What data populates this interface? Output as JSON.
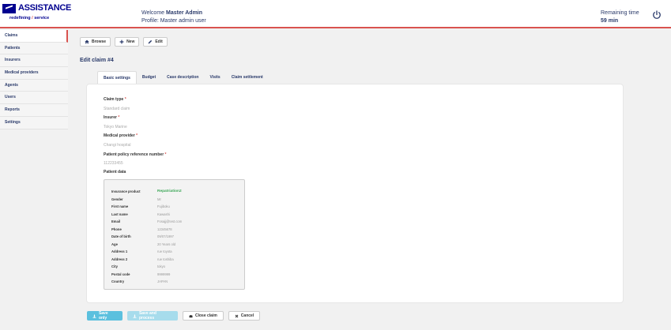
{
  "header": {
    "brand": "ASSISTANCE",
    "tagline_a": "redefining",
    "tagline_slash": "/",
    "tagline_b": "service",
    "welcome_prefix": "Welcome",
    "welcome_name": "Master Admin",
    "profile": "Profile: Master admin user",
    "remaining_label": "Remaining time",
    "remaining_value": "59 min"
  },
  "sidebar": {
    "items": [
      {
        "label": "Claims"
      },
      {
        "label": "Patients"
      },
      {
        "label": "Insurers"
      },
      {
        "label": "Medical providers"
      },
      {
        "label": "Agents"
      },
      {
        "label": "Users"
      },
      {
        "label": "Reports"
      },
      {
        "label": "Settings"
      }
    ]
  },
  "toolbar": {
    "browse": "Browse",
    "new": "New",
    "edit": "Edit"
  },
  "page": {
    "title": "Edit claim #4"
  },
  "tabs": [
    {
      "label": "Basic settings"
    },
    {
      "label": "Budget"
    },
    {
      "label": "Case description"
    },
    {
      "label": "Visits"
    },
    {
      "label": "Claim settlement"
    }
  ],
  "form": {
    "claim_type_label": "Claim type",
    "claim_type_value": "Standard claim",
    "insurer_label": "Insurer",
    "insurer_value": "Tokyo Marine",
    "provider_label": "Medical provider",
    "provider_value": "Changi hospital",
    "policy_label": "Patient policy reference number",
    "policy_value": "112233455",
    "patient_data_label": "Patient data",
    "required_mark": "*"
  },
  "patient": {
    "rows": [
      {
        "key": "Insurance product",
        "value": "Repatriation2"
      },
      {
        "key": "Gender",
        "value": "Mr"
      },
      {
        "key": "First name",
        "value": "Fujiboku"
      },
      {
        "key": "Last name",
        "value": "Kawashi"
      },
      {
        "key": "Email",
        "value": "Fosajj@test.com"
      },
      {
        "key": "Phone",
        "value": "12345678"
      },
      {
        "key": "Date of birth",
        "value": "09/07/1997"
      },
      {
        "key": "Age",
        "value": "20 Years old"
      },
      {
        "key": "Address 1",
        "value": "rue toyota"
      },
      {
        "key": "Address 2",
        "value": "rue toshiba"
      },
      {
        "key": "City",
        "value": "tokyo"
      },
      {
        "key": "Postal code",
        "value": "9999999"
      },
      {
        "key": "Country",
        "value": "JAPAN"
      }
    ]
  },
  "actions": {
    "save_only": "Save only",
    "save_process": "Save and process",
    "close_claim": "Close claim",
    "cancel": "Cancel"
  },
  "colors": {
    "brand": "#00008f",
    "accent": "#d9534f",
    "primary_button": "#5bc0de",
    "green_value": "#3aa655"
  }
}
